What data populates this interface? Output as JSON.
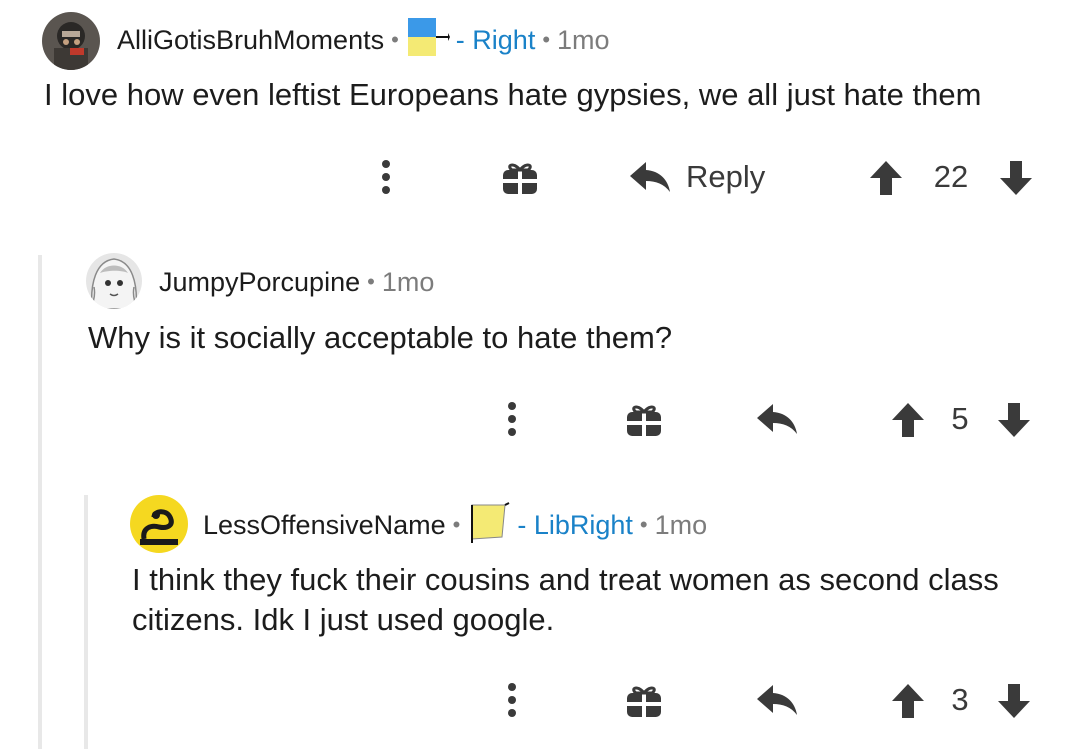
{
  "comments": [
    {
      "username": "AlliGotisBruhMoments",
      "separator": "•",
      "flair": "- Right",
      "flair_colors": [
        "#3b99e8",
        "#f4ea74"
      ],
      "time": "1mo",
      "body": [
        "I love how even leftist Europeans hate gypsies,  we all just hate them"
      ],
      "reply_label": "Reply",
      "score": "22"
    },
    {
      "username": "JumpyPorcupine",
      "separator": "•",
      "time": "1mo",
      "body": [
        "Why is it socially acceptable to hate them?"
      ],
      "score": "5"
    },
    {
      "username": "LessOffensiveName",
      "separator": "•",
      "flair": "- LibRight",
      "flair_colors": [
        "#f4ea74"
      ],
      "time": "1mo",
      "body": [
        "I think they fuck their cousins and treat women as second class",
        "citizens. Idk I just used google."
      ],
      "score": "3"
    }
  ],
  "icons": {
    "more": "more-vertical-icon",
    "award": "gift-award-icon",
    "reply": "reply-arrow-icon",
    "upvote": "upvote-arrow-icon",
    "downvote": "downvote-arrow-icon"
  },
  "colors": {
    "text": "#1c1c1c",
    "muted": "#7c7c7c",
    "flair_text": "#1a82c8",
    "icon": "#3a3a3a",
    "thread_line": "#e8e8e8"
  }
}
